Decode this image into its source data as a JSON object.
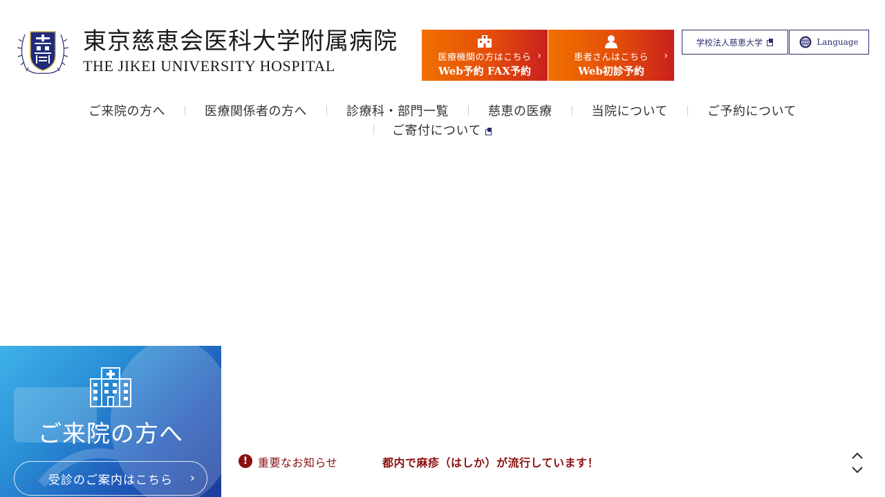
{
  "logo": {
    "name_ja": "東京慈恵会医科大学附属病院",
    "name_en": "THE JIKEI UNIVERSITY HOSPITAL"
  },
  "reservation": [
    {
      "line1": "医療機関の方はこちら",
      "line2": "Web予約 FAX予約",
      "icon": "hospital-icon"
    },
    {
      "line1": "患者さんはこちら",
      "line2": "Web初診予約",
      "icon": "person-icon"
    }
  ],
  "utility": {
    "university_label": "学校法人慈恵大学",
    "language_label": "Language"
  },
  "nav": {
    "items": [
      "ご来院の方へ",
      "医療関係者の方へ",
      "診療科・部門一覧",
      "慈恵の医療",
      "当院について",
      "ご予約について",
      "ご寄付について"
    ]
  },
  "visitor_panel": {
    "title": "ご来院の方へ",
    "button_label": "受診のご案内はこちら"
  },
  "notice": {
    "label": "重要なお知らせ",
    "text": "都内で麻疹（はしか）が流行しています！"
  },
  "colors": {
    "brand_navy": "#2b2e6e",
    "reservation_orange": "#f07000",
    "reservation_red": "#c9201e",
    "notice_red": "#8a1010"
  }
}
